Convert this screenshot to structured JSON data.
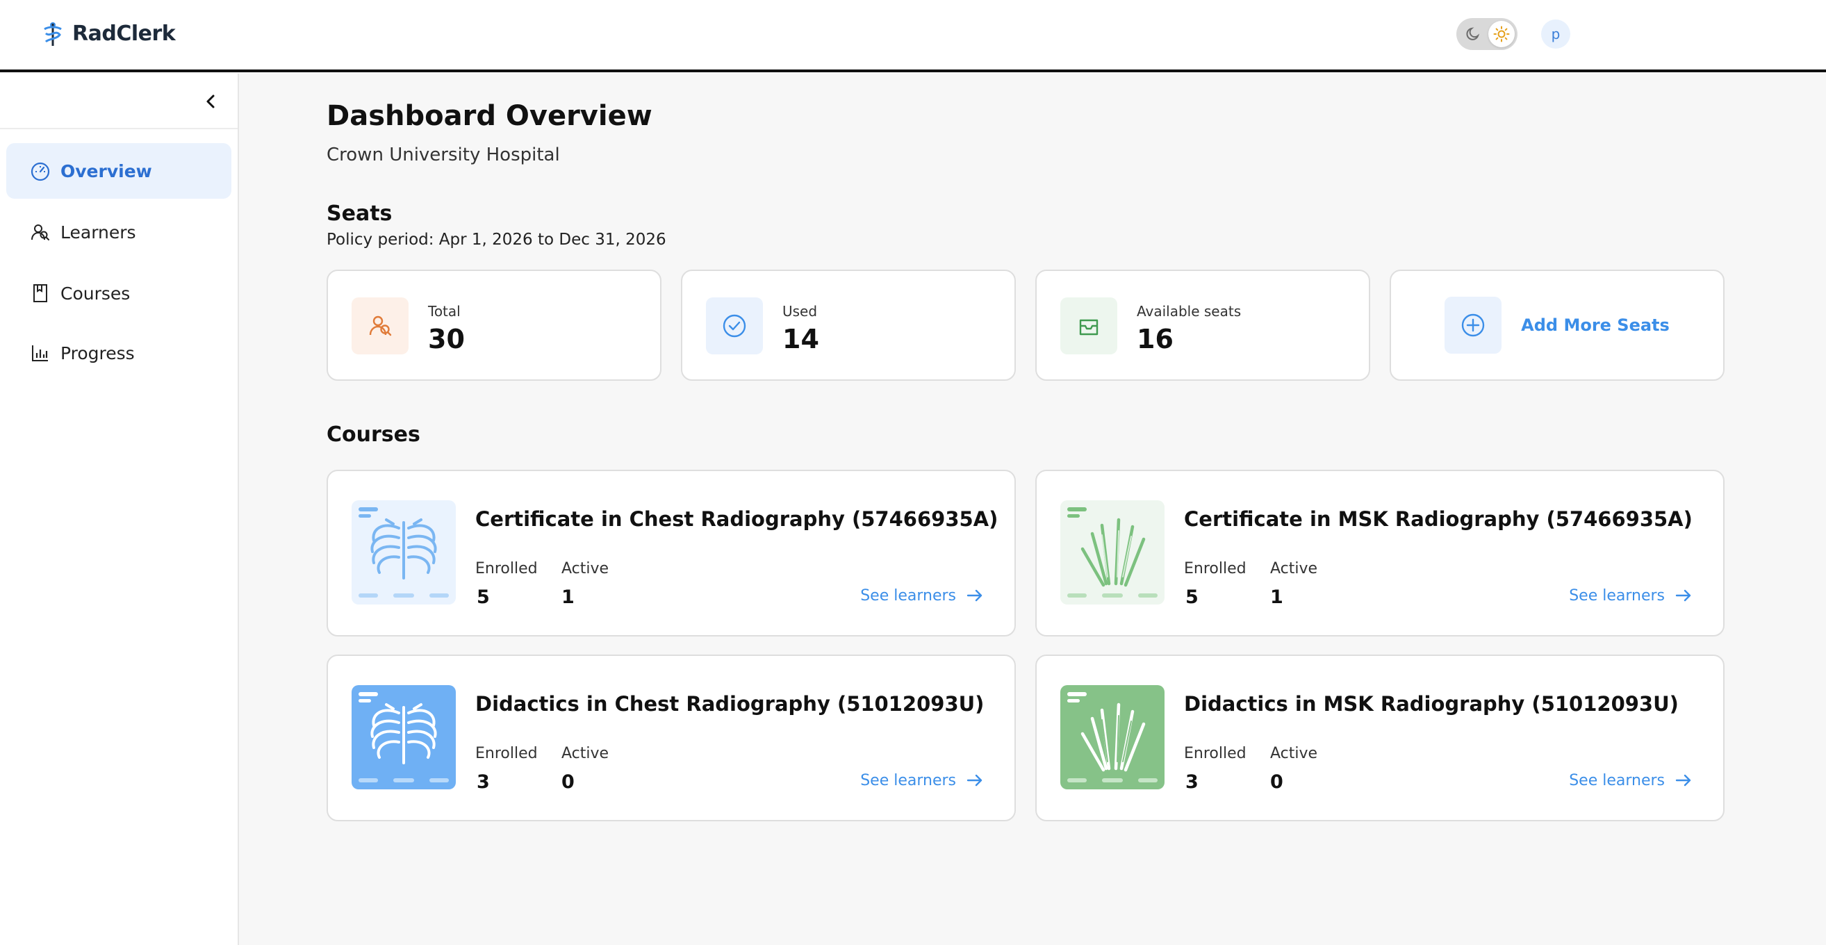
{
  "header": {
    "brand": "RadClerk",
    "avatar_initial": "p",
    "theme": "light"
  },
  "sidebar": {
    "items": [
      {
        "label": "Overview",
        "icon": "speedometer-icon",
        "active": true
      },
      {
        "label": "Learners",
        "icon": "users-icon",
        "active": false
      },
      {
        "label": "Courses",
        "icon": "book-icon",
        "active": false
      },
      {
        "label": "Progress",
        "icon": "bar-chart-icon",
        "active": false
      }
    ]
  },
  "main": {
    "title": "Dashboard Overview",
    "organization": "Crown University Hospital",
    "seats": {
      "heading": "Seats",
      "policy_period": "Policy period: Apr 1, 2026 to Dec 31, 2026",
      "total": {
        "label": "Total",
        "value": "30",
        "color": "#e07b39"
      },
      "used": {
        "label": "Used",
        "value": "14",
        "color": "#3b8ee8"
      },
      "available": {
        "label": "Available seats",
        "value": "16",
        "color": "#3f9a4f"
      },
      "add_more_label": "Add More Seats"
    },
    "courses": {
      "heading": "Courses",
      "items": [
        {
          "title": "Certificate in Chest Radiography (57466935A)",
          "enrolled_label": "Enrolled",
          "enrolled": "5",
          "active_label": "Active",
          "active": "1",
          "link_label": "See learners",
          "thumbnail": "chest-xray-light-icon"
        },
        {
          "title": "Certificate in MSK Radiography (57466935A)",
          "enrolled_label": "Enrolled",
          "enrolled": "5",
          "active_label": "Active",
          "active": "1",
          "link_label": "See learners",
          "thumbnail": "hand-xray-light-icon"
        },
        {
          "title": "Didactics in Chest Radiography (51012093U)",
          "enrolled_label": "Enrolled",
          "enrolled": "3",
          "active_label": "Active",
          "active": "0",
          "link_label": "See learners",
          "thumbnail": "chest-xray-solid-icon"
        },
        {
          "title": "Didactics in MSK Radiography (51012093U)",
          "enrolled_label": "Enrolled",
          "enrolled": "3",
          "active_label": "Active",
          "active": "0",
          "link_label": "See learners",
          "thumbnail": "hand-xray-solid-icon"
        }
      ]
    }
  },
  "colors": {
    "accent": "#3b8ee8",
    "nav_active_bg": "#eaf2fd",
    "nav_active_text": "#2c6fd1"
  }
}
